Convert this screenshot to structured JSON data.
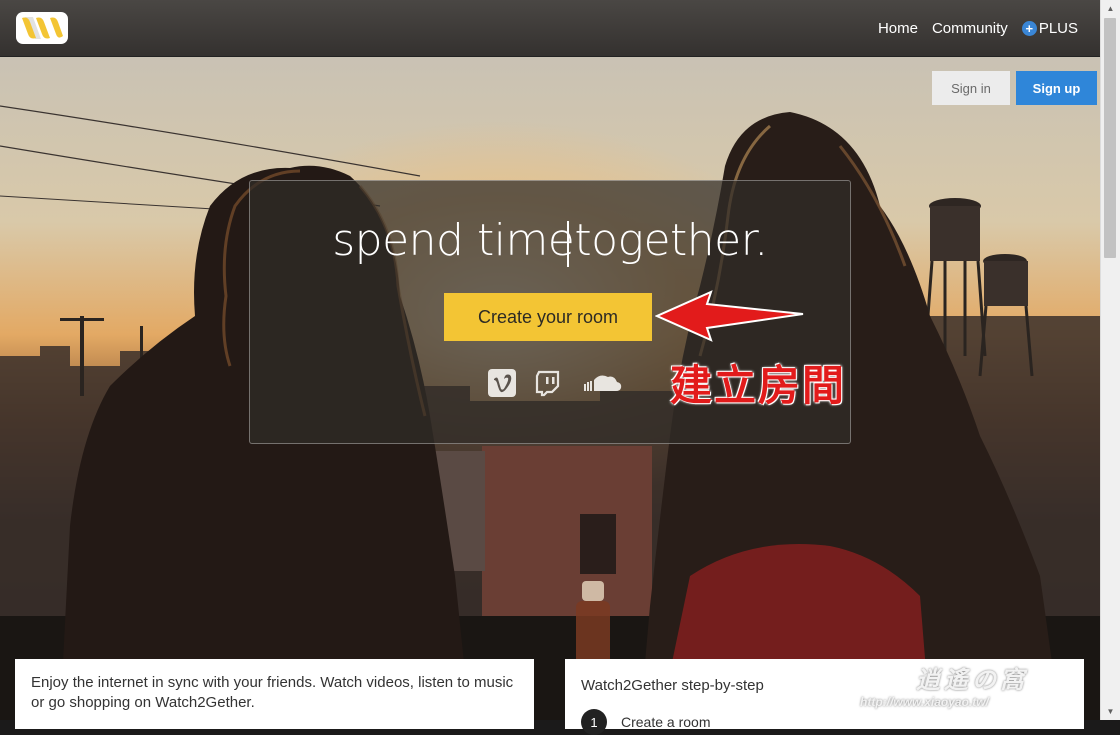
{
  "navbar": {
    "home_label": "Home",
    "community_label": "Community",
    "plus_label": "PLUS",
    "plus_icon_glyph": "+"
  },
  "auth": {
    "signin_label": "Sign in",
    "signup_label": "Sign up"
  },
  "hero": {
    "tagline": "spend timetogether.",
    "create_button_label": "Create your room",
    "services": [
      "vimeo-icon",
      "twitch-icon",
      "soundcloud-icon"
    ]
  },
  "annotation": {
    "text": "建立房間",
    "color": "#e21b1b"
  },
  "intro_card": {
    "text": "Enjoy the internet in sync with your friends. Watch videos, listen to music or go shopping on Watch2Gether."
  },
  "steps_card": {
    "title": "Watch2Gether step-by-step",
    "steps": [
      {
        "number": "1",
        "label": "Create a room"
      }
    ]
  },
  "watermark": {
    "title": "逍遙の窩",
    "url": "http://www.xiaoyao.tw/"
  },
  "colors": {
    "accent_yellow": "#f3c534",
    "signup_blue": "#2f86d9",
    "navbar_bg": "#3e3b38"
  }
}
